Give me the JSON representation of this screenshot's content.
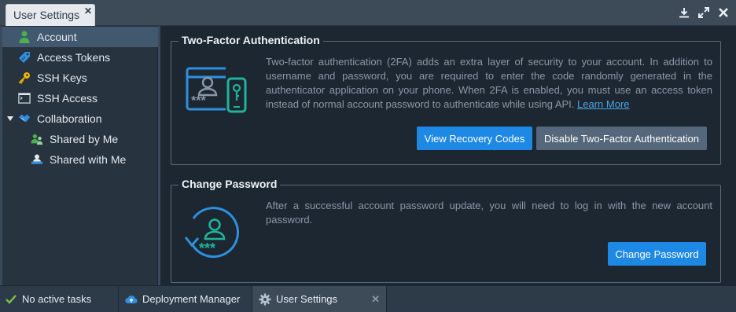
{
  "window": {
    "tab_title": "User Settings",
    "close_glyph": "✕",
    "controls": [
      "download-icon",
      "expand-icon",
      "close-icon"
    ]
  },
  "sidebar": {
    "items": [
      {
        "label": "Account",
        "icon": "user-icon",
        "active": true
      },
      {
        "label": "Access Tokens",
        "icon": "tag-icon"
      },
      {
        "label": "SSH Keys",
        "icon": "key-icon"
      },
      {
        "label": "SSH Access",
        "icon": "terminal-icon"
      },
      {
        "label": "Collaboration",
        "icon": "handshake-icon",
        "expanded": true
      },
      {
        "label": "Shared by Me",
        "icon": "users-icon"
      },
      {
        "label": "Shared with Me",
        "icon": "user-share-icon"
      }
    ]
  },
  "two_factor": {
    "title": "Two-Factor Authentication",
    "description": "Two-factor authentication (2FA) adds an extra layer of security to your account. In addition to username and password, you are required to enter the code randomly generated in the authenticator application on your phone. When 2FA is enabled, you must use an access token instead of normal account password to authenticate while using API.",
    "learn_more": "Learn More",
    "view_codes_label": "View Recovery Codes",
    "disable_label": "Disable Two-Factor Authentication"
  },
  "change_password": {
    "title": "Change Password",
    "description": "After a successful account password update, you will need to log in with the new account password.",
    "button_label": "Change Password"
  },
  "taskbar": {
    "status": "No active tasks",
    "items": [
      {
        "label": "Deployment Manager",
        "icon": "cloud-icon"
      },
      {
        "label": "User Settings",
        "icon": "gear-icon",
        "active": true
      }
    ],
    "close_glyph": "✕"
  },
  "colors": {
    "accent": "#1e88e5",
    "secondary_button": "#55677a",
    "icon_blue": "#2f8fe0",
    "icon_teal": "#1fb39a",
    "status_green": "#7bc043"
  }
}
